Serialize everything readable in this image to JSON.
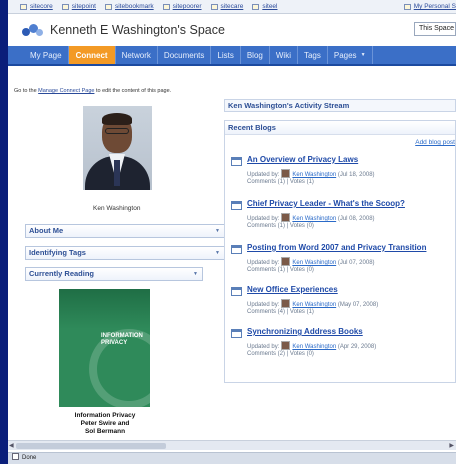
{
  "browser": {
    "bookmarks": [
      {
        "label": "sitecore"
      },
      {
        "label": "sitepoint"
      },
      {
        "label": "sitebookmark"
      },
      {
        "label": "sitepoorer"
      },
      {
        "label": "sitecare"
      },
      {
        "label": "siteel"
      }
    ],
    "bookmark_right": "My Personal S",
    "status": "Done"
  },
  "header": {
    "site_title": "Kenneth E Washington's Space",
    "search_scope": "This Space"
  },
  "nav": {
    "tabs": [
      {
        "label": "My Page"
      },
      {
        "label": "Connect",
        "active": true
      },
      {
        "label": "Network"
      },
      {
        "label": "Documents"
      },
      {
        "label": "Lists"
      },
      {
        "label": "Blog"
      },
      {
        "label": "Wiki"
      },
      {
        "label": "Tags"
      },
      {
        "label": "Pages"
      }
    ]
  },
  "left": {
    "intro_prefix": "Go to the",
    "intro_link": "Manage Connect Page",
    "intro_suffix": "to edit the content of this page.",
    "person_name": "Ken Washington",
    "about_me": "About Me",
    "identifying_tags": "Identifying Tags",
    "currently_reading": "Currently Reading",
    "book": {
      "cover_title_1": "INFORMATION",
      "cover_title_2": "PRIVACY",
      "caption_1": "Information Privacy",
      "caption_2": "Peter Swire and",
      "caption_3": "Sol Bermann"
    }
  },
  "right": {
    "activity_stream": "Ken Washington's Activity Stream",
    "recent_blogs": "Recent Blogs",
    "add_blog_post": "Add blog post",
    "posts": [
      {
        "title": "An Overview of Privacy Laws",
        "updated_by": "Updated by:",
        "author": "Ken Washington",
        "date": "(Jul 18, 2008)",
        "comments": "Comments (1)",
        "votes": "Votes (1)"
      },
      {
        "title": "Chief Privacy Leader - What's the Scoop?",
        "updated_by": "Updated by:",
        "author": "Ken Washington",
        "date": "(Jul 08, 2008)",
        "comments": "Comments (1)",
        "votes": "Votes (0)"
      },
      {
        "title": "Posting from Word 2007 and Privacy Transition",
        "updated_by": "Updated by:",
        "author": "Ken Washington",
        "date": "(Jul 07, 2008)",
        "comments": "Comments (1)",
        "votes": "Votes (0)"
      },
      {
        "title": "New Office Experiences",
        "updated_by": "Updated by:",
        "author": "Ken Washington",
        "date": "(May 07, 2008)",
        "comments": "Comments (4)",
        "votes": "Votes (1)"
      },
      {
        "title": "Synchronizing Address Books",
        "updated_by": "Updated by:",
        "author": "Ken Washington",
        "date": "(Apr 29, 2008)",
        "comments": "Comments (2)",
        "votes": "Votes (0)"
      }
    ]
  },
  "colors": {
    "nav_blue": "#3b6fc7",
    "active_tab": "#f39a25",
    "link_blue": "#1f4aa8",
    "desktop": "#0a1e7a"
  }
}
